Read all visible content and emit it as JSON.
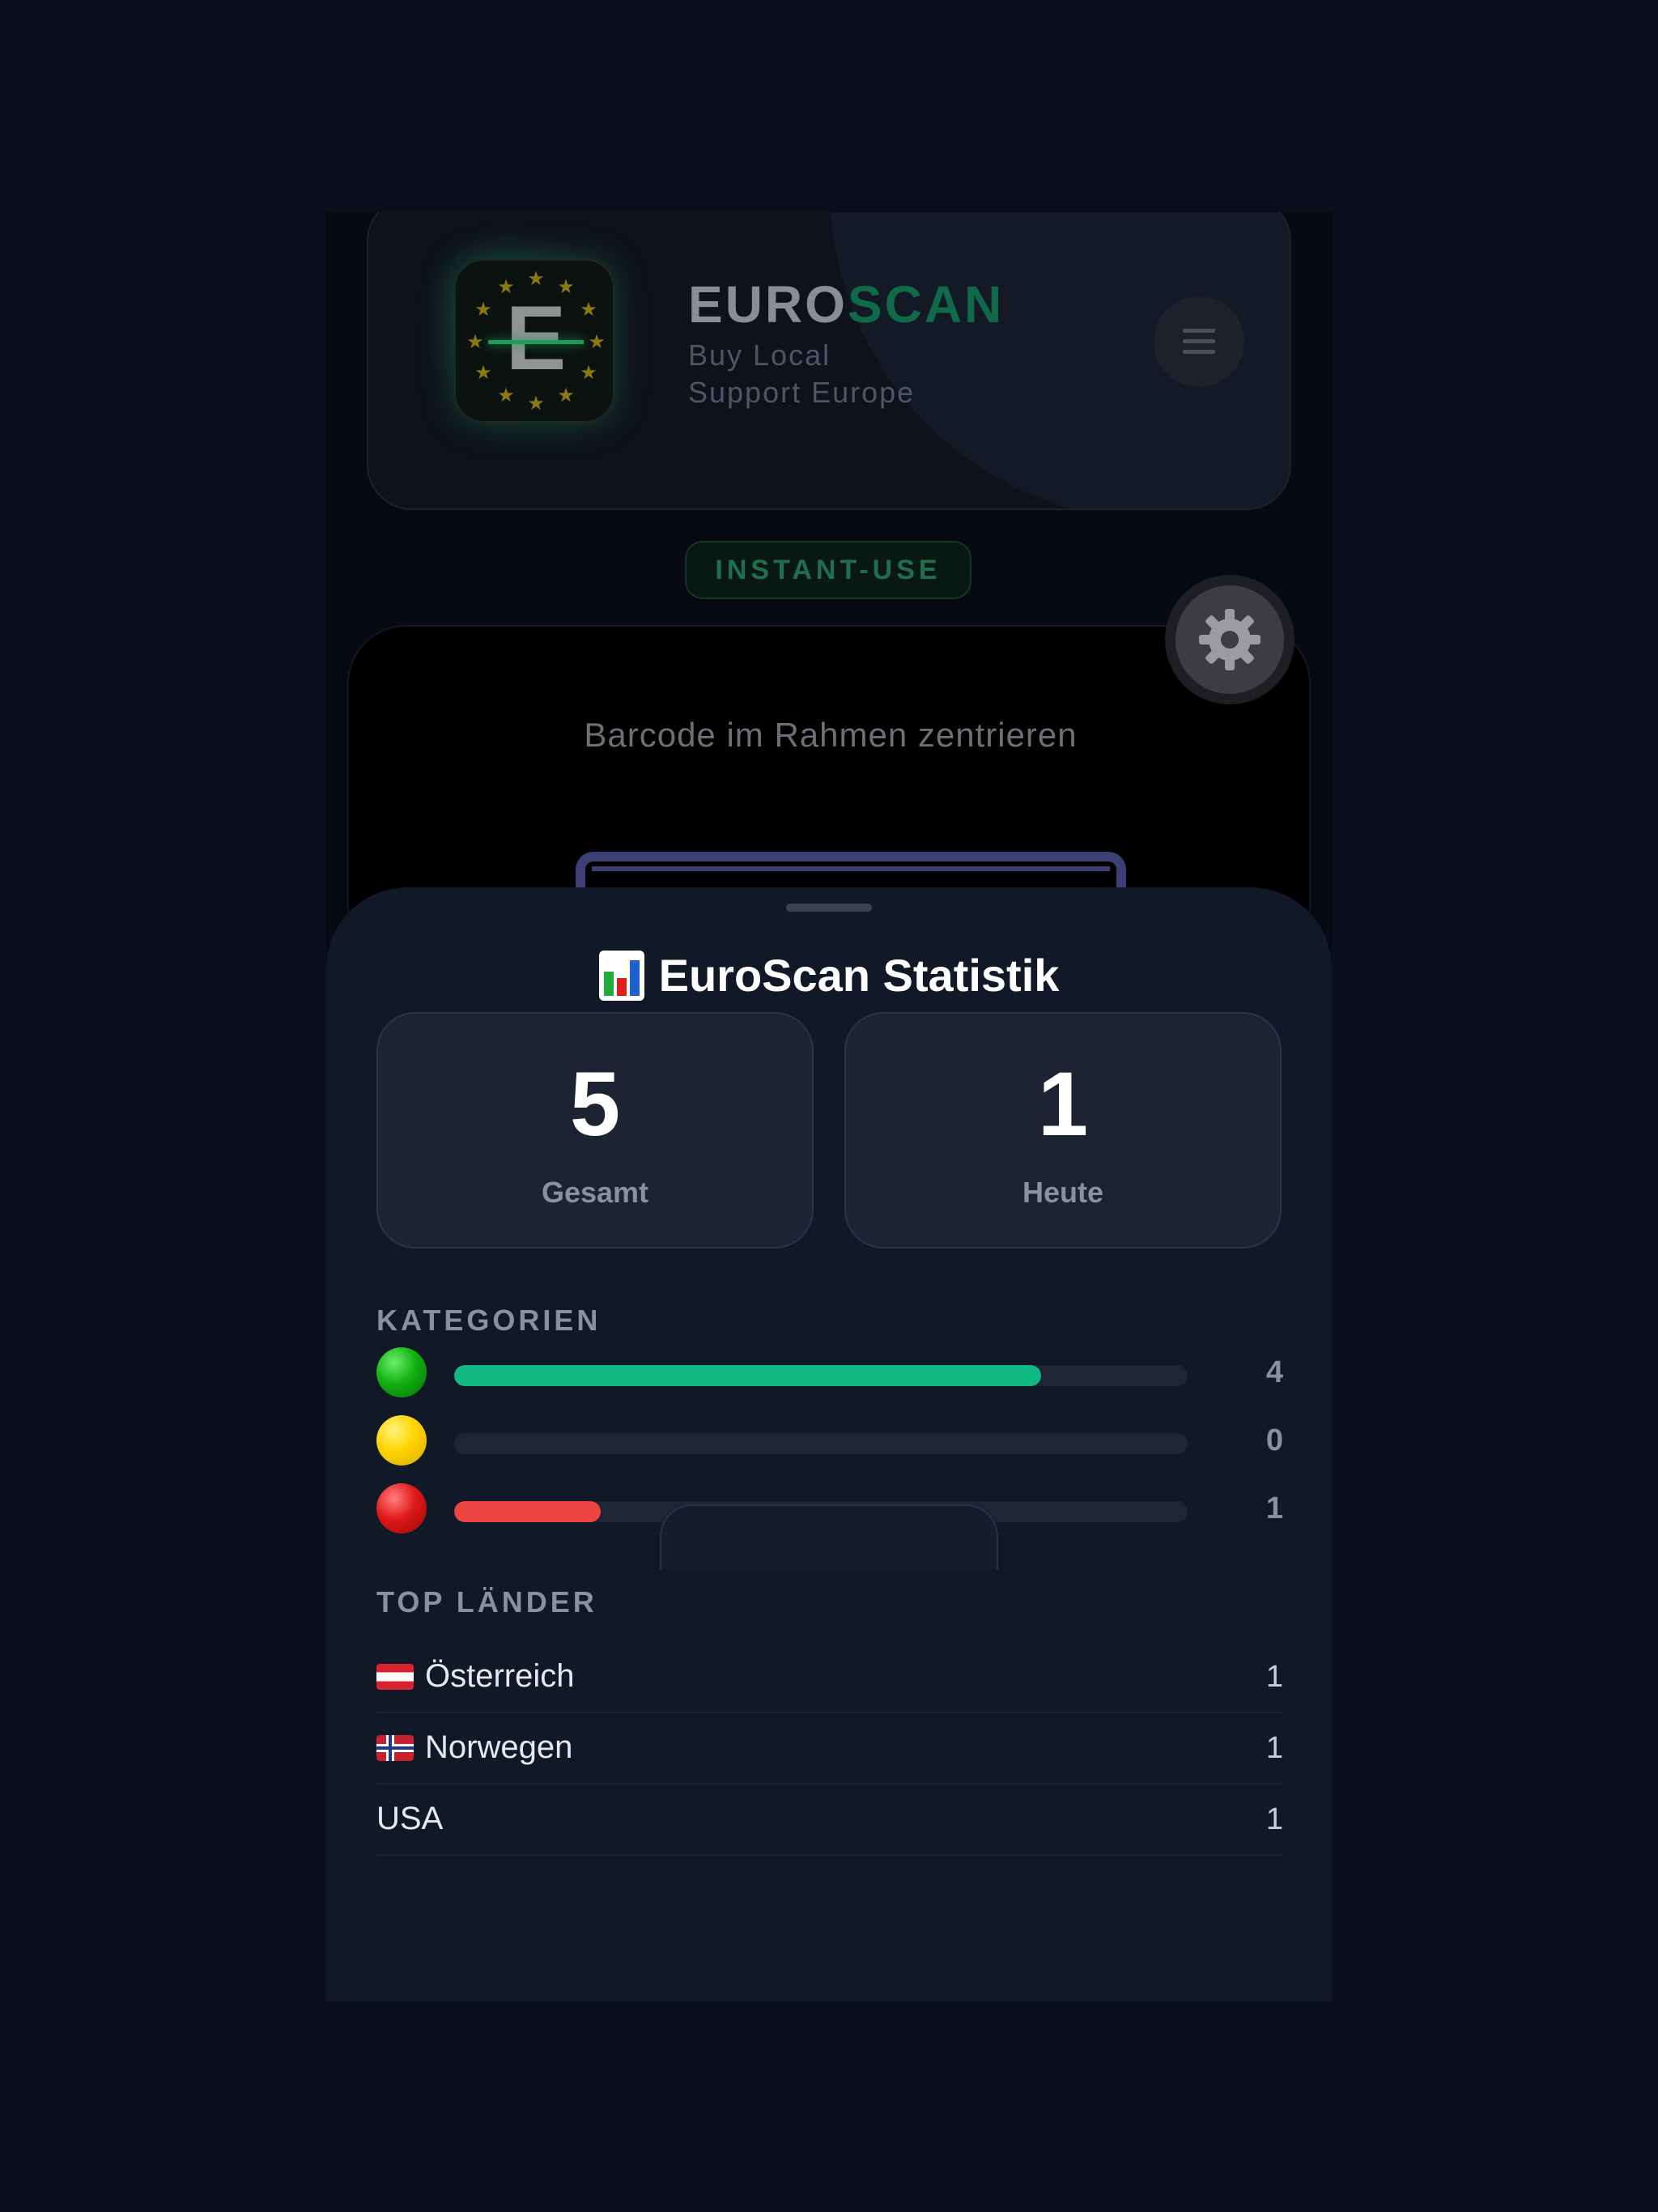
{
  "header": {
    "brand_euro": "EURO",
    "brand_scan": "SCAN",
    "tagline_line1": "Buy Local",
    "tagline_line2": "Support Europe",
    "logo_letter": "E"
  },
  "badge": {
    "label": "INSTANT-USE"
  },
  "scanner": {
    "hint": "Barcode im Rahmen zentrieren"
  },
  "stats": {
    "title": "EuroScan Statistik",
    "total": {
      "value": "5",
      "label": "Gesamt"
    },
    "today": {
      "value": "1",
      "label": "Heute"
    },
    "categories_label": "KATEGORIEN",
    "categories": [
      {
        "name": "green",
        "count": "4",
        "fraction": 0.8,
        "color": "#10b981"
      },
      {
        "name": "yellow",
        "count": "0",
        "fraction": 0.0,
        "color": "#f5c400"
      },
      {
        "name": "red",
        "count": "1",
        "fraction": 0.2,
        "color": "#ef4444"
      }
    ],
    "countries_label": "TOP LÄNDER",
    "countries": [
      {
        "name": "Österreich",
        "count": "1",
        "flag": "austria"
      },
      {
        "name": "Norwegen",
        "count": "1",
        "flag": "norway"
      },
      {
        "name": "USA",
        "count": "1",
        "flag": ""
      }
    ]
  }
}
